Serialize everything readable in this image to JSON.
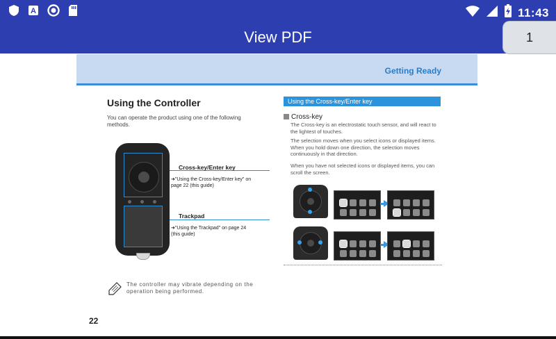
{
  "status_bar": {
    "time": "11:43",
    "left_icons": [
      "shield-icon",
      "font-a-icon",
      "circle-sync-icon",
      "sd-card-icon"
    ],
    "right_icons": [
      "wifi-icon",
      "signal-icon",
      "battery-icon"
    ],
    "color": "#2d3fb0"
  },
  "app_bar": {
    "title": "View PDF",
    "page_indicator": "1"
  },
  "document": {
    "section_title": "Getting Ready",
    "left": {
      "heading": "Using the Controller",
      "intro": "You can operate the product using one of the following methods.",
      "callouts": [
        {
          "label": "Cross-key/Enter key",
          "ref": "➜\"Using the Cross-key/Enter key\" on page 22 (this guide)"
        },
        {
          "label": "Trackpad",
          "ref": "➜\"Using the Trackpad\" on page 24 (this guide)"
        }
      ],
      "note": "The controller may vibrate depending on the operation being performed.",
      "page_number": "22"
    },
    "right": {
      "bar_title": "Using the Cross-key/Enter key",
      "sub_heading": "Cross-key",
      "paragraphs": [
        "The Cross-key is an electrostatic touch sensor, and will react to the lightest of touches.",
        "The selection moves when you select icons or displayed items. When you hold down one direction, the selection moves continuously in that direction.",
        "When you have not selected icons or displayed items, you can scroll the screen."
      ]
    }
  }
}
